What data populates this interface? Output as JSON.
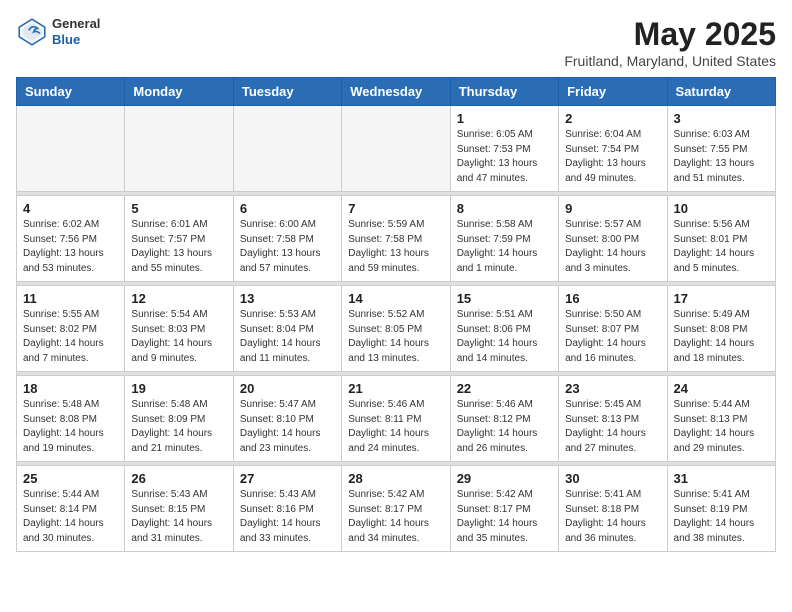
{
  "header": {
    "logo_general": "General",
    "logo_blue": "Blue",
    "month_year": "May 2025",
    "location": "Fruitland, Maryland, United States"
  },
  "weekdays": [
    "Sunday",
    "Monday",
    "Tuesday",
    "Wednesday",
    "Thursday",
    "Friday",
    "Saturday"
  ],
  "weeks": [
    {
      "days": [
        {
          "num": "",
          "info": ""
        },
        {
          "num": "",
          "info": ""
        },
        {
          "num": "",
          "info": ""
        },
        {
          "num": "",
          "info": ""
        },
        {
          "num": "1",
          "info": "Sunrise: 6:05 AM\nSunset: 7:53 PM\nDaylight: 13 hours\nand 47 minutes."
        },
        {
          "num": "2",
          "info": "Sunrise: 6:04 AM\nSunset: 7:54 PM\nDaylight: 13 hours\nand 49 minutes."
        },
        {
          "num": "3",
          "info": "Sunrise: 6:03 AM\nSunset: 7:55 PM\nDaylight: 13 hours\nand 51 minutes."
        }
      ]
    },
    {
      "days": [
        {
          "num": "4",
          "info": "Sunrise: 6:02 AM\nSunset: 7:56 PM\nDaylight: 13 hours\nand 53 minutes."
        },
        {
          "num": "5",
          "info": "Sunrise: 6:01 AM\nSunset: 7:57 PM\nDaylight: 13 hours\nand 55 minutes."
        },
        {
          "num": "6",
          "info": "Sunrise: 6:00 AM\nSunset: 7:58 PM\nDaylight: 13 hours\nand 57 minutes."
        },
        {
          "num": "7",
          "info": "Sunrise: 5:59 AM\nSunset: 7:58 PM\nDaylight: 13 hours\nand 59 minutes."
        },
        {
          "num": "8",
          "info": "Sunrise: 5:58 AM\nSunset: 7:59 PM\nDaylight: 14 hours\nand 1 minute."
        },
        {
          "num": "9",
          "info": "Sunrise: 5:57 AM\nSunset: 8:00 PM\nDaylight: 14 hours\nand 3 minutes."
        },
        {
          "num": "10",
          "info": "Sunrise: 5:56 AM\nSunset: 8:01 PM\nDaylight: 14 hours\nand 5 minutes."
        }
      ]
    },
    {
      "days": [
        {
          "num": "11",
          "info": "Sunrise: 5:55 AM\nSunset: 8:02 PM\nDaylight: 14 hours\nand 7 minutes."
        },
        {
          "num": "12",
          "info": "Sunrise: 5:54 AM\nSunset: 8:03 PM\nDaylight: 14 hours\nand 9 minutes."
        },
        {
          "num": "13",
          "info": "Sunrise: 5:53 AM\nSunset: 8:04 PM\nDaylight: 14 hours\nand 11 minutes."
        },
        {
          "num": "14",
          "info": "Sunrise: 5:52 AM\nSunset: 8:05 PM\nDaylight: 14 hours\nand 13 minutes."
        },
        {
          "num": "15",
          "info": "Sunrise: 5:51 AM\nSunset: 8:06 PM\nDaylight: 14 hours\nand 14 minutes."
        },
        {
          "num": "16",
          "info": "Sunrise: 5:50 AM\nSunset: 8:07 PM\nDaylight: 14 hours\nand 16 minutes."
        },
        {
          "num": "17",
          "info": "Sunrise: 5:49 AM\nSunset: 8:08 PM\nDaylight: 14 hours\nand 18 minutes."
        }
      ]
    },
    {
      "days": [
        {
          "num": "18",
          "info": "Sunrise: 5:48 AM\nSunset: 8:08 PM\nDaylight: 14 hours\nand 19 minutes."
        },
        {
          "num": "19",
          "info": "Sunrise: 5:48 AM\nSunset: 8:09 PM\nDaylight: 14 hours\nand 21 minutes."
        },
        {
          "num": "20",
          "info": "Sunrise: 5:47 AM\nSunset: 8:10 PM\nDaylight: 14 hours\nand 23 minutes."
        },
        {
          "num": "21",
          "info": "Sunrise: 5:46 AM\nSunset: 8:11 PM\nDaylight: 14 hours\nand 24 minutes."
        },
        {
          "num": "22",
          "info": "Sunrise: 5:46 AM\nSunset: 8:12 PM\nDaylight: 14 hours\nand 26 minutes."
        },
        {
          "num": "23",
          "info": "Sunrise: 5:45 AM\nSunset: 8:13 PM\nDaylight: 14 hours\nand 27 minutes."
        },
        {
          "num": "24",
          "info": "Sunrise: 5:44 AM\nSunset: 8:13 PM\nDaylight: 14 hours\nand 29 minutes."
        }
      ]
    },
    {
      "days": [
        {
          "num": "25",
          "info": "Sunrise: 5:44 AM\nSunset: 8:14 PM\nDaylight: 14 hours\nand 30 minutes."
        },
        {
          "num": "26",
          "info": "Sunrise: 5:43 AM\nSunset: 8:15 PM\nDaylight: 14 hours\nand 31 minutes."
        },
        {
          "num": "27",
          "info": "Sunrise: 5:43 AM\nSunset: 8:16 PM\nDaylight: 14 hours\nand 33 minutes."
        },
        {
          "num": "28",
          "info": "Sunrise: 5:42 AM\nSunset: 8:17 PM\nDaylight: 14 hours\nand 34 minutes."
        },
        {
          "num": "29",
          "info": "Sunrise: 5:42 AM\nSunset: 8:17 PM\nDaylight: 14 hours\nand 35 minutes."
        },
        {
          "num": "30",
          "info": "Sunrise: 5:41 AM\nSunset: 8:18 PM\nDaylight: 14 hours\nand 36 minutes."
        },
        {
          "num": "31",
          "info": "Sunrise: 5:41 AM\nSunset: 8:19 PM\nDaylight: 14 hours\nand 38 minutes."
        }
      ]
    }
  ]
}
